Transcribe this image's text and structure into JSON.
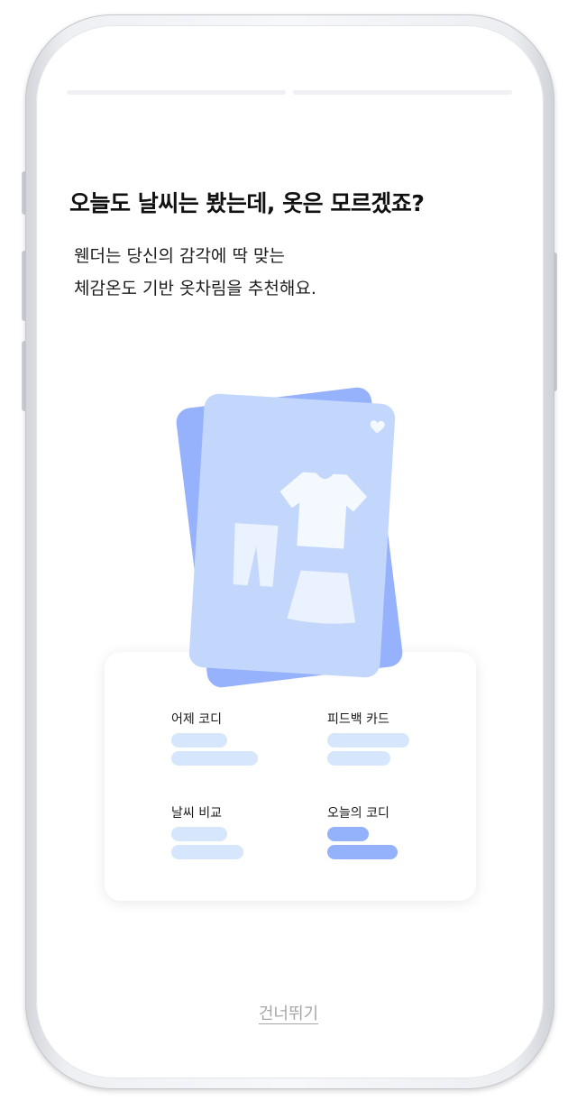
{
  "onboarding": {
    "step_current": 1,
    "step_total": 2,
    "title": "오늘도 날씨는 봤는데, 옷은 모르겠죠?",
    "subtitle_line1": "웬더는 당신의 감각에 딱 맞는",
    "subtitle_line2": "체감온도 기반 옷차림을 추천해요."
  },
  "preview_panel": {
    "items": [
      {
        "label": "어제 코디"
      },
      {
        "label": "피드백 카드"
      },
      {
        "label": "날씨 비교"
      },
      {
        "label": "오늘의 코디"
      }
    ]
  },
  "illustration": {
    "icons": [
      "heart-icon",
      "tshirt-icon",
      "pants-icon",
      "skirt-icon"
    ]
  },
  "skip_label": "건너뛰기",
  "colors": {
    "card_back": "#97b2fd",
    "card_front": "#c3d7fd",
    "pill_light": "#d5e6fd",
    "pill_accent": "#94b1fc",
    "skip_text": "#a6a6a6"
  }
}
